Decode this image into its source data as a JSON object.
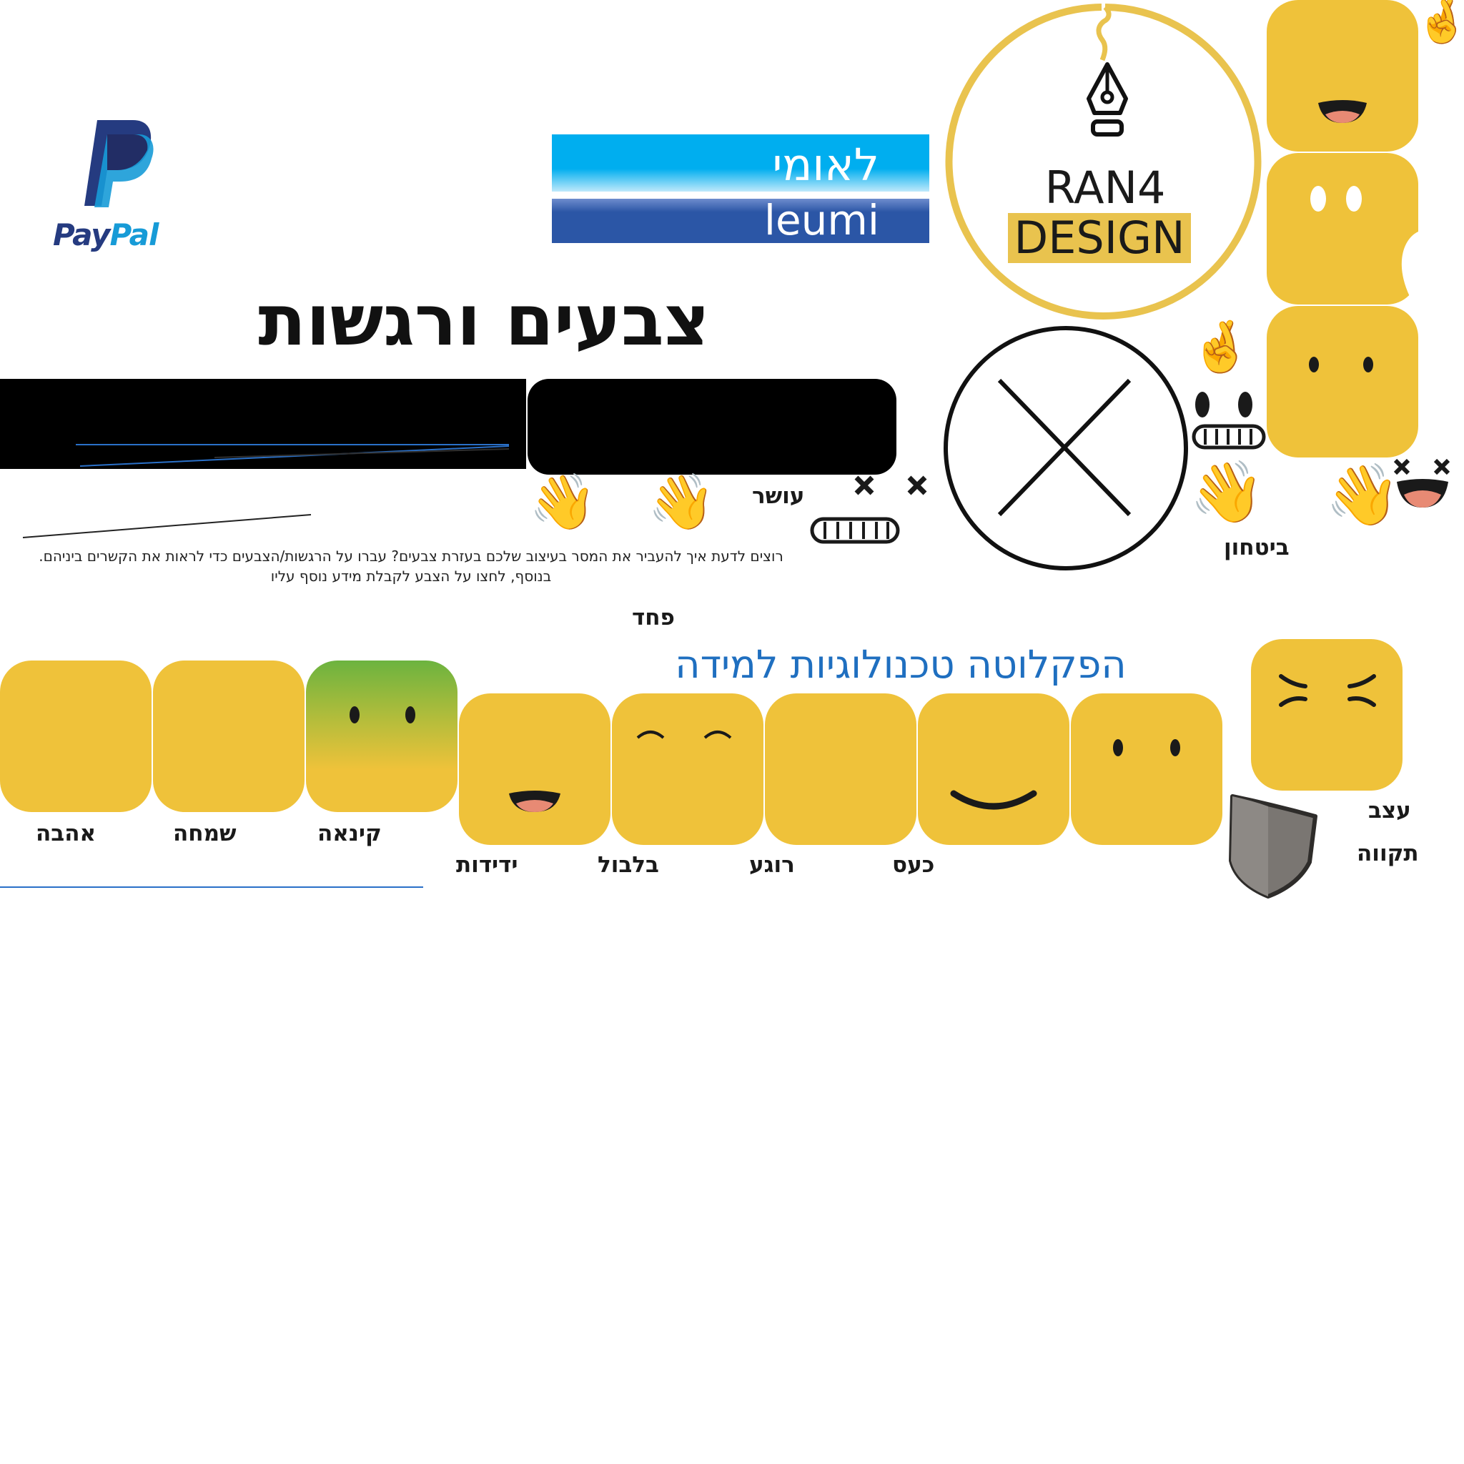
{
  "logos": {
    "paypal": {
      "wordmark_pay": "Pay",
      "wordmark_pal": "Pal",
      "colors": {
        "dark": "#253b80",
        "light": "#179bd7"
      }
    },
    "leumi": {
      "hebrew": "לאומי",
      "latin": "leumi",
      "colors": {
        "top": "#00aeef",
        "bottom": "#2b56a6"
      }
    },
    "ran4": {
      "line1": "RAN4",
      "line2": "DESIGN",
      "ring_color": "#e9c34e",
      "icon": "pen-nib-icon"
    }
  },
  "page": {
    "title": "צבעים ורגשות",
    "intro_line1": "רוצים לדעת איך להעביר את המסר בעיצוב שלכם בעזרת צבעים? עברו על הרגשות/הצבעים כדי לראות את הקשרים ביניהם.",
    "intro_line2": "בנוסף, לחצו על הצבע לקבלת מידע נוסף עליו",
    "faculty_title": "הפקלוטה טכנולוגיות למידה",
    "faculty_title_color": "#1f6fc0",
    "close_button_icon": "close-icon"
  },
  "emotions": {
    "wealth": "עושר",
    "confidence": "ביטחון",
    "fear": "פחד",
    "sadness": "עצב",
    "hope": "תקווה",
    "anger": "כעס",
    "calm": "רוגע",
    "confusion": "בלבול",
    "friendliness": "ידידות",
    "envy": "קינאה",
    "joy": "שמחה",
    "love": "אהבה"
  },
  "colors": {
    "tile_yellow": "#efc23a",
    "envy_green": "#6cb33f",
    "shield_gray": "#7a7672"
  },
  "icons": {
    "wave": "👋",
    "crossed_fingers": "🤞",
    "shield": "shield-icon"
  }
}
